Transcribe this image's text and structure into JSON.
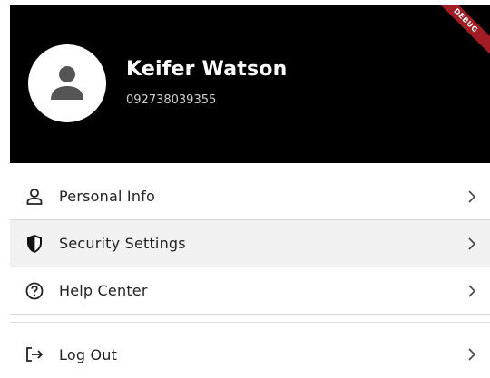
{
  "profile": {
    "name": "Keifer Watson",
    "phone": "092738039355",
    "avatar_icon": "person-icon"
  },
  "debug_banner": {
    "label": "DEBUG",
    "color": "#a31c24"
  },
  "menu": {
    "items": [
      {
        "label": "Personal Info",
        "icon": "person-outline-icon"
      },
      {
        "label": "Security Settings",
        "icon": "shield-icon"
      },
      {
        "label": "Help Center",
        "icon": "help-circle-icon"
      },
      {
        "label": "Log Out",
        "icon": "logout-icon"
      }
    ]
  },
  "colors": {
    "header_bg": "#000000",
    "selected_row_bg": "#f1f1f1",
    "text": "#222222"
  }
}
